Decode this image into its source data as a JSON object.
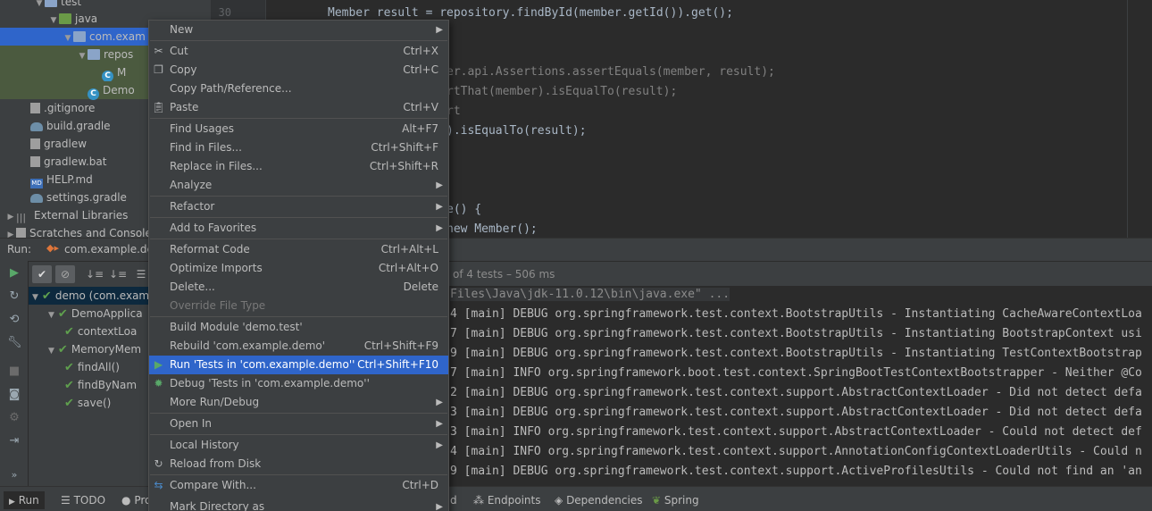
{
  "tree": {
    "items": [
      {
        "label": "test",
        "depth": 3,
        "type": "folder"
      },
      {
        "label": "java",
        "depth": 4,
        "type": "folder-green"
      },
      {
        "label": "com.exam",
        "depth": 5,
        "type": "folder"
      },
      {
        "label": "repos",
        "depth": 6,
        "type": "folder"
      },
      {
        "label": "M",
        "depth": 7,
        "type": "class"
      },
      {
        "label": "Demo",
        "depth": 6,
        "type": "class"
      },
      {
        "label": ".gitignore",
        "depth": 2,
        "type": "file"
      },
      {
        "label": "build.gradle",
        "depth": 2,
        "type": "gradle"
      },
      {
        "label": "gradlew",
        "depth": 2,
        "type": "file"
      },
      {
        "label": "gradlew.bat",
        "depth": 2,
        "type": "file"
      },
      {
        "label": "HELP.md",
        "depth": 2,
        "type": "md"
      },
      {
        "label": "settings.gradle",
        "depth": 2,
        "type": "gradle"
      },
      {
        "label": "External Libraries",
        "depth": 1,
        "type": "libs"
      },
      {
        "label": "Scratches and Console",
        "depth": 1,
        "type": "file"
      }
    ]
  },
  "gutter": {
    "line": "30"
  },
  "editor": {
    "lines": [
      "Member result = repository.findById(member.getId()).get();",
      "",
      "",
      "er.api.Assertions.assertEquals(member, result);",
      "rtThat(member).isEqualTo(result);",
      "rt",
      ").isEqualTo(result);",
      "",
      "",
      "",
      "e() {",
      "new Member();"
    ]
  },
  "run": {
    "label": "Run:",
    "config_tab": "com.example.demo",
    "status": "of 4 tests – 506 ms",
    "tests": [
      {
        "label": "demo (com.exam",
        "depth": 0
      },
      {
        "label": "DemoApplica",
        "depth": 1
      },
      {
        "label": "contextLoa",
        "depth": 2
      },
      {
        "label": "MemoryMem",
        "depth": 1
      },
      {
        "label": "findAll()",
        "depth": 2
      },
      {
        "label": "findByNam",
        "depth": 2
      },
      {
        "label": "save()",
        "depth": 2
      }
    ],
    "console": [
      "Files\\Java\\jdk-11.0.12\\bin\\java.exe\" ...",
      "4 [main] DEBUG org.springframework.test.context.BootstrapUtils - Instantiating CacheAwareContextLoa",
      "7 [main] DEBUG org.springframework.test.context.BootstrapUtils - Instantiating BootstrapContext usi",
      "9 [main] DEBUG org.springframework.test.context.BootstrapUtils - Instantiating TestContextBootstrap",
      "7 [main] INFO org.springframework.boot.test.context.SpringBootTestContextBootstrapper - Neither @Co",
      "2 [main] DEBUG org.springframework.test.context.support.AbstractContextLoader - Did not detect defa",
      "3 [main] DEBUG org.springframework.test.context.support.AbstractContextLoader - Did not detect defa",
      "3 [main] INFO org.springframework.test.context.support.AbstractContextLoader - Could not detect def",
      "4 [main] INFO org.springframework.test.context.support.AnnotationConfigContextLoaderUtils - Could n",
      "9 [main] DEBUG org.springframework.test.context.support.ActiveProfilesUtils - Could not find an 'an"
    ]
  },
  "bottom_tabs": [
    "Run",
    "TODO",
    "Pro",
    "d",
    "Endpoints",
    "Dependencies",
    "Spring"
  ],
  "menu": {
    "items": [
      {
        "label": "New",
        "shortcut": "",
        "submenu": true,
        "icon": ""
      },
      {
        "label": "Cut",
        "shortcut": "Ctrl+X",
        "submenu": false,
        "icon": "scissors-icon"
      },
      {
        "label": "Copy",
        "shortcut": "Ctrl+C",
        "submenu": false,
        "icon": "copy-icon"
      },
      {
        "label": "Copy Path/Reference...",
        "shortcut": "",
        "submenu": false,
        "icon": ""
      },
      {
        "label": "Paste",
        "shortcut": "Ctrl+V",
        "submenu": false,
        "icon": "clipboard-icon"
      },
      {
        "label": "Find Usages",
        "shortcut": "Alt+F7",
        "submenu": false,
        "icon": ""
      },
      {
        "label": "Find in Files...",
        "shortcut": "Ctrl+Shift+F",
        "submenu": false,
        "icon": ""
      },
      {
        "label": "Replace in Files...",
        "shortcut": "Ctrl+Shift+R",
        "submenu": false,
        "icon": ""
      },
      {
        "label": "Analyze",
        "shortcut": "",
        "submenu": true,
        "icon": ""
      },
      {
        "label": "Refactor",
        "shortcut": "",
        "submenu": true,
        "icon": ""
      },
      {
        "label": "Add to Favorites",
        "shortcut": "",
        "submenu": true,
        "icon": ""
      },
      {
        "label": "Reformat Code",
        "shortcut": "Ctrl+Alt+L",
        "submenu": false,
        "icon": ""
      },
      {
        "label": "Optimize Imports",
        "shortcut": "Ctrl+Alt+O",
        "submenu": false,
        "icon": ""
      },
      {
        "label": "Delete...",
        "shortcut": "Delete",
        "submenu": false,
        "icon": ""
      },
      {
        "label": "Override File Type",
        "shortcut": "",
        "submenu": false,
        "icon": "",
        "disabled": true
      },
      {
        "label": "Build Module 'demo.test'",
        "shortcut": "",
        "submenu": false,
        "icon": ""
      },
      {
        "label": "Rebuild 'com.example.demo'",
        "shortcut": "Ctrl+Shift+F9",
        "submenu": false,
        "icon": ""
      },
      {
        "label": "Run 'Tests in 'com.example.demo''",
        "shortcut": "Ctrl+Shift+F10",
        "submenu": false,
        "icon": "run-icon",
        "highlighted": true
      },
      {
        "label": "Debug 'Tests in 'com.example.demo''",
        "shortcut": "",
        "submenu": false,
        "icon": "debug-icon"
      },
      {
        "label": "More Run/Debug",
        "shortcut": "",
        "submenu": true,
        "icon": ""
      },
      {
        "label": "Open In",
        "shortcut": "",
        "submenu": true,
        "icon": ""
      },
      {
        "label": "Local History",
        "shortcut": "",
        "submenu": true,
        "icon": ""
      },
      {
        "label": "Reload from Disk",
        "shortcut": "",
        "submenu": false,
        "icon": "reload-icon"
      },
      {
        "label": "Compare With...",
        "shortcut": "Ctrl+D",
        "submenu": false,
        "icon": "compare-icon"
      },
      {
        "label": "Mark Directory as",
        "shortcut": "",
        "submenu": true,
        "icon": ""
      }
    ]
  },
  "colors": {
    "accent": "#2f65ca",
    "success": "#5fa04e",
    "menu_bg": "#3c3f41"
  }
}
